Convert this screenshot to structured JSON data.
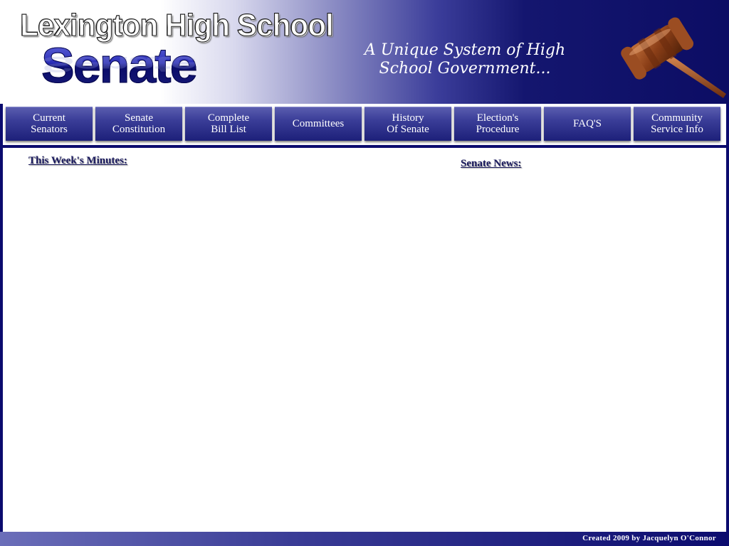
{
  "header": {
    "school_name": "Lexington High School",
    "site_name": "Senate",
    "tagline": "A Unique System of High School Government...",
    "gavel_icon": "gavel-icon"
  },
  "nav": {
    "items": [
      {
        "label": "Current\nSenators"
      },
      {
        "label": "Senate\nConstitution"
      },
      {
        "label": "Complete\nBill List"
      },
      {
        "label": "Committees"
      },
      {
        "label": "History\nOf Senate"
      },
      {
        "label": "Election's\nProcedure"
      },
      {
        "label": "FAQ'S"
      },
      {
        "label": "Community\nService Info"
      }
    ]
  },
  "main": {
    "minutes_heading": "This Week's Minutes:",
    "news_heading": "Senate News:"
  },
  "footer": {
    "credit": "Created 2009 by Jacquelyn O'Connor"
  },
  "colors": {
    "navy": "#0b0b6e",
    "nav_button": "#3a3d98",
    "heading_text": "#1a1a5e"
  }
}
